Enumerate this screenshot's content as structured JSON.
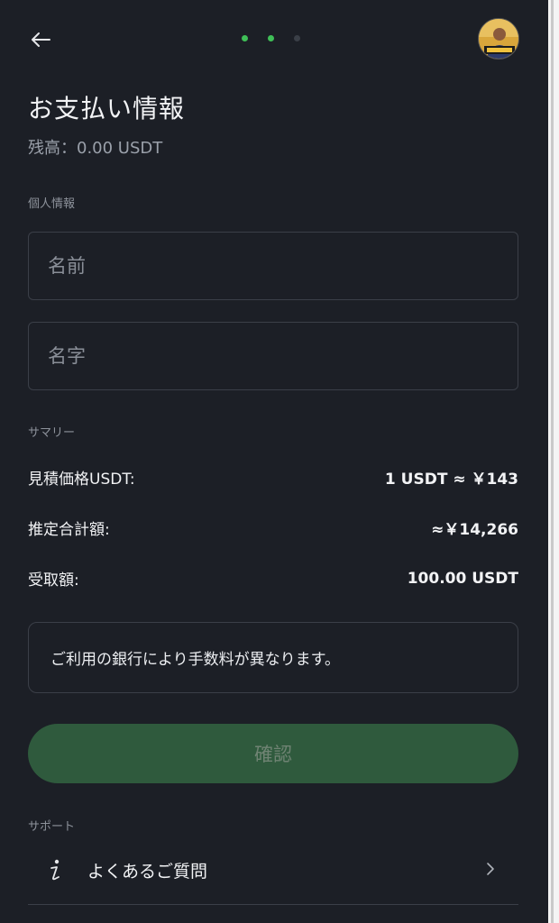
{
  "header": {
    "steps": {
      "total": 3,
      "current": 2
    }
  },
  "page": {
    "title": "お支払い情報",
    "balance": "残高：0.00 USDT"
  },
  "personal": {
    "section_label": "個人情報",
    "first_name_placeholder": "名前",
    "last_name_placeholder": "名字"
  },
  "summary": {
    "section_label": "サマリー",
    "rows": [
      {
        "label": "見積価格USDT:",
        "value": "1 USDT ≈ ￥143"
      },
      {
        "label": "推定合計額:",
        "value": "≈￥14,266"
      },
      {
        "label": "受取額:",
        "value": "100.00 USDT"
      }
    ]
  },
  "notice": "ご利用の銀行により手数料が異なります。",
  "confirm_label": "確認",
  "support": {
    "section_label": "サポート",
    "faq_label": "よくあるご質問"
  },
  "colors": {
    "background": "#1c1f26",
    "accent": "#3fbf57",
    "button_disabled": "#2f5a3d"
  }
}
